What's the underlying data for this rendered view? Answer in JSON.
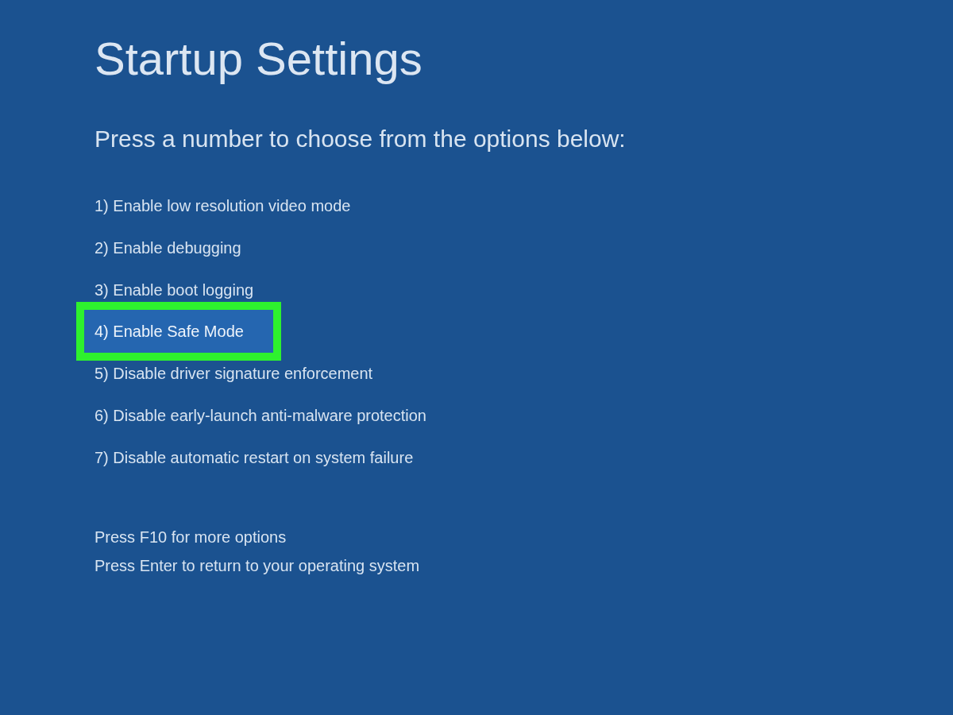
{
  "title": "Startup Settings",
  "prompt": "Press a number to choose from the options below:",
  "options": [
    {
      "label": "1) Enable low resolution video mode",
      "highlighted": false
    },
    {
      "label": "2) Enable debugging",
      "highlighted": false
    },
    {
      "label": "3) Enable boot logging",
      "highlighted": false
    },
    {
      "label": "4) Enable Safe Mode",
      "highlighted": true
    },
    {
      "label": "5) Disable driver signature enforcement",
      "highlighted": false
    },
    {
      "label": "6) Disable early-launch anti-malware protection",
      "highlighted": false
    },
    {
      "label": "7) Disable automatic restart on system failure",
      "highlighted": false
    }
  ],
  "footer_lines": [
    "Press F10 for more options",
    "Press Enter to return to your operating system"
  ]
}
